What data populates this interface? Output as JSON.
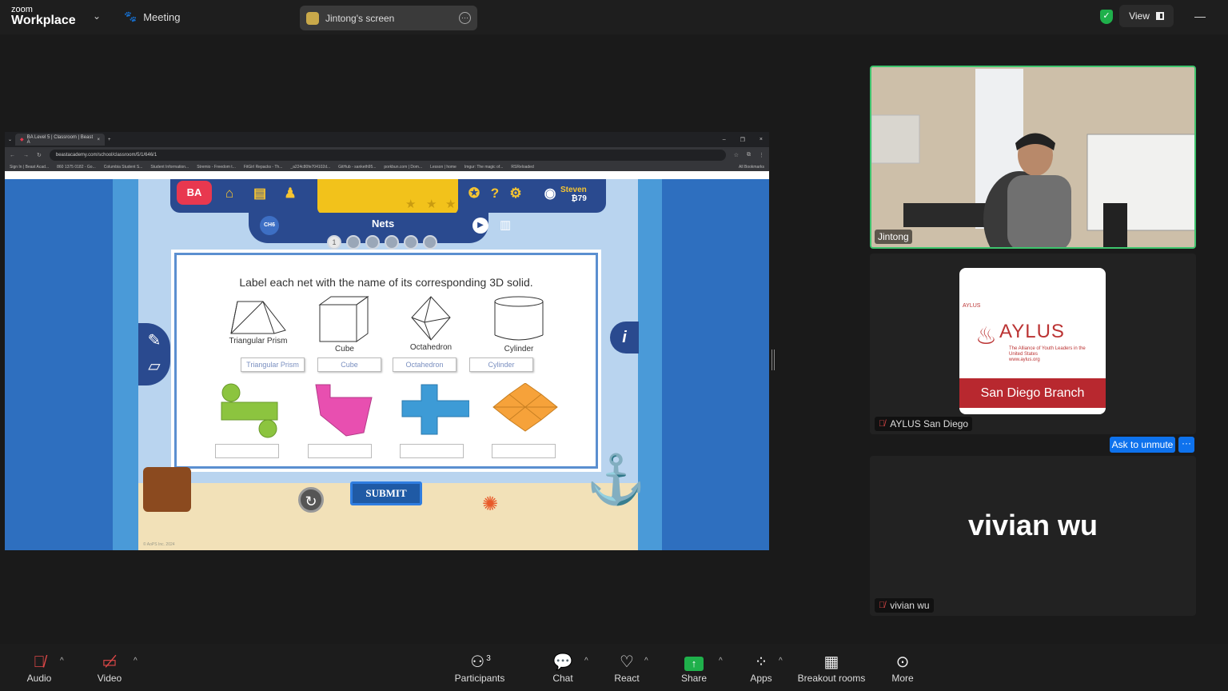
{
  "app": {
    "brand_small": "zoom",
    "brand": "Workplace",
    "meeting_label": "Meeting",
    "screen_pill": "Jintong's screen",
    "view_label": "View"
  },
  "browser": {
    "tab_title": "BA Level 5 | Classroom | Beast A",
    "url": "beastacademy.com/school/classroom/5/1/646/1",
    "bookmarks": [
      "Sign In | Beast Acad...",
      "860 1375 0182 - Go...",
      "Columbia Student S...",
      "Student Information...",
      "Stremio - Freedom t...",
      "FitGirl Repacks - Th...",
      "_a224c80fe704102d...",
      "GitHub - sanketh95...",
      "porkbun.com | Dom...",
      "Lesson | home",
      "Imgur: The magic of...",
      "RSReloaded",
      "All Bookmarks"
    ]
  },
  "game": {
    "logo": "BA",
    "user": "Steven",
    "coins": "79",
    "chapter_badge": "CH6",
    "section": "Nets",
    "progress_dots": [
      "1",
      "",
      "",
      "",
      "",
      ""
    ],
    "prompt": "Label each net with the name of its corresponding 3D solid.",
    "solids": [
      "Triangular Prism",
      "Cube",
      "Octahedron",
      "Cylinder"
    ],
    "chips": [
      "Triangular Prism",
      "Cube",
      "Octahedron",
      "Cylinder"
    ],
    "submit": "SUBMIT",
    "copyright": "© AoPS Inc. 2024",
    "colors": {
      "net1": "#8cc43f",
      "net2": "#e84fb0",
      "net3": "#3d9bd6",
      "net4": "#f6a23a"
    }
  },
  "participants": {
    "video_name": "Jintong",
    "aylus": {
      "small": "AYLUS",
      "big": "AYLUS",
      "tagline": "The Alliance of Youth Leaders in the United States",
      "site": "www.aylus.org",
      "band": "San Diego Branch",
      "name": "AYLUS San Diego"
    },
    "ask_unmute": "Ask to unmute",
    "vivian_big": "vivian wu",
    "vivian_name": "vivian wu"
  },
  "toolbar": {
    "audio": "Audio",
    "video": "Video",
    "participants": "Participants",
    "participants_count": "3",
    "chat": "Chat",
    "react": "React",
    "share": "Share",
    "apps": "Apps",
    "breakout": "Breakout rooms",
    "more": "More"
  }
}
